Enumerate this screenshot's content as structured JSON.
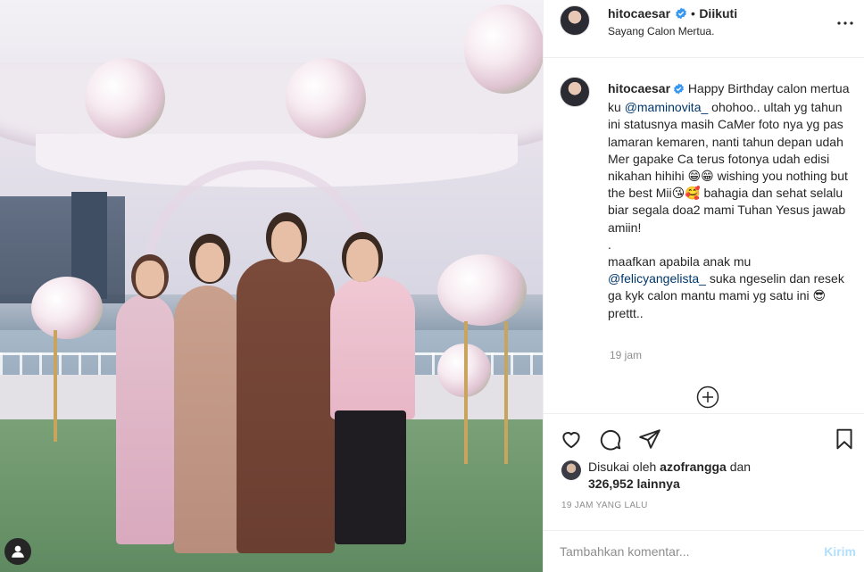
{
  "post": {
    "username": "hitocaesar",
    "follow_status": "Diikuti",
    "location": "Sayang Calon Mertua.",
    "caption": {
      "part1": " Happy Birthday calon mertua ku ",
      "mention1": "@maminovita_",
      "part2": " ohohoo.. ultah yg tahun ini statusnya masih CaMer foto nya yg pas lamaran kemaren, nanti tahun depan udah Mer gapake Ca terus fotonya udah edisi nikahan hihihi 😁😁 wishing you nothing but the best Mii😘🥰 bahagia dan sehat selalu biar segala doa2 mami Tuhan Yesus jawab amiin!",
      "dot": ".",
      "part3_before": "maafkan apabila anak mu ",
      "mention2": "@felicyangelista_",
      "part3_after": " suka ngeselin dan resek ga kyk calon mantu mami yg satu ini 😎 prettt.."
    },
    "caption_time": "19 jam",
    "liked_by_prefix": "Disukai oleh ",
    "liked_by_user": "azofrangga",
    "liked_by_and": " dan",
    "likes_count": "326,952 lainnya",
    "timestamp": "19 JAM YANG LALU"
  },
  "comment_box": {
    "placeholder": "Tambahkan komentar...",
    "post_label": "Kirim"
  },
  "icons": {
    "more": "more-horizontal-icon",
    "like": "heart-icon",
    "comment": "comment-icon",
    "share": "send-icon",
    "save": "bookmark-icon",
    "load_more": "plus-circle-icon",
    "tagged": "user-tag-icon",
    "verified": "verified-badge-icon"
  },
  "colors": {
    "verified": "#3897f0",
    "mention": "#00376b",
    "post_button_disabled": "#b2dffc",
    "muted_text": "#8e8e8e"
  }
}
